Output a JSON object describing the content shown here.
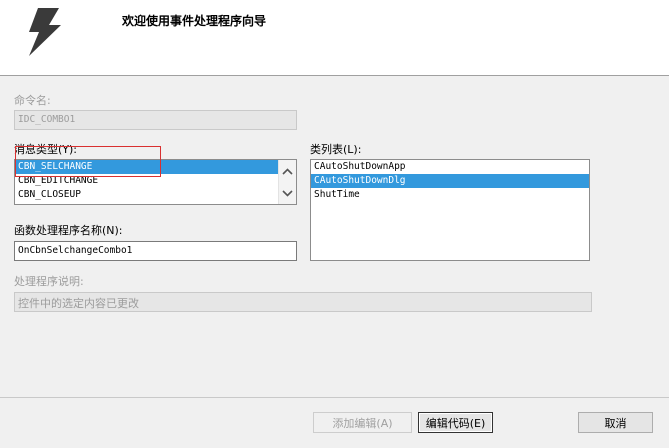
{
  "header": {
    "title": "欢迎使用事件处理程序向导",
    "icon": "lightning-bolt-icon"
  },
  "command_name": {
    "label": "命令名:",
    "value": "IDC_COMBO1"
  },
  "message_type": {
    "label": "消息类型(Y):",
    "items": [
      "CBN_SELCHANGE",
      "CBN_EDITCHANGE",
      "CBN_CLOSEUP"
    ],
    "selected_index": 0
  },
  "class_list": {
    "label": "类列表(L):",
    "items": [
      "CAutoShutDownApp",
      "CAutoShutDownDlg",
      "ShutTime"
    ],
    "selected_index": 1
  },
  "function_name": {
    "label": "函数处理程序名称(N):",
    "value": "OnCbnSelchangeCombo1"
  },
  "handler_description": {
    "label": "处理程序说明:",
    "value": "控件中的选定内容已更改"
  },
  "buttons": {
    "add_edit": "添加编辑(A)",
    "edit_code": "编辑代码(E)",
    "cancel": "取消"
  },
  "colors": {
    "selection": "#3399dd",
    "highlight_box": "#d93030"
  }
}
